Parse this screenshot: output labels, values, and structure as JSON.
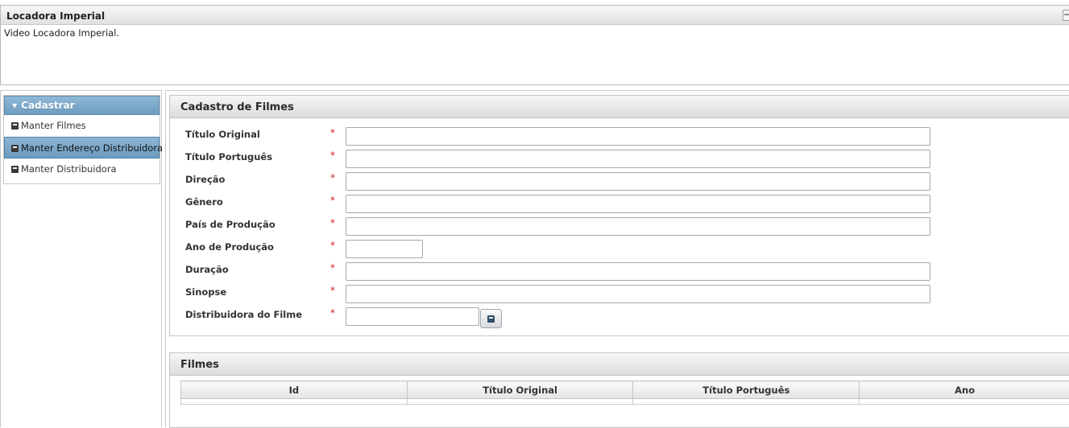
{
  "header": {
    "title": "Locadora Imperial",
    "description": "Video Locadora Imperial."
  },
  "menu": {
    "title": "Cadastrar",
    "items": [
      {
        "label": "Manter Filmes",
        "active": false
      },
      {
        "label": "Manter Endereço Distribuidora",
        "active": true
      },
      {
        "label": "Manter Distribuidora",
        "active": false
      }
    ]
  },
  "form": {
    "title": "Cadastro de Filmes",
    "required_marker": "*",
    "fields": [
      {
        "label": "Título Original",
        "value": ""
      },
      {
        "label": "Título Português",
        "value": ""
      },
      {
        "label": "Direção",
        "value": ""
      },
      {
        "label": "Gênero",
        "value": ""
      },
      {
        "label": "País de Produção",
        "value": ""
      },
      {
        "label": "Ano de Produção",
        "value": ""
      },
      {
        "label": "Duração",
        "value": ""
      },
      {
        "label": "Sinopse",
        "value": ""
      },
      {
        "label": "Distribuidora do Filme",
        "value": ""
      }
    ]
  },
  "films": {
    "title": "Filmes",
    "columns": [
      "Id",
      "Título Original",
      "Título Português",
      "Ano"
    ]
  },
  "colors": {
    "menu_header": "#7aa7c9",
    "active_item": "#7aa7c9",
    "required": "#d01f1f"
  },
  "icons": {
    "menu_item_icon": "form-icon",
    "lookup_icon": "form-icon"
  }
}
